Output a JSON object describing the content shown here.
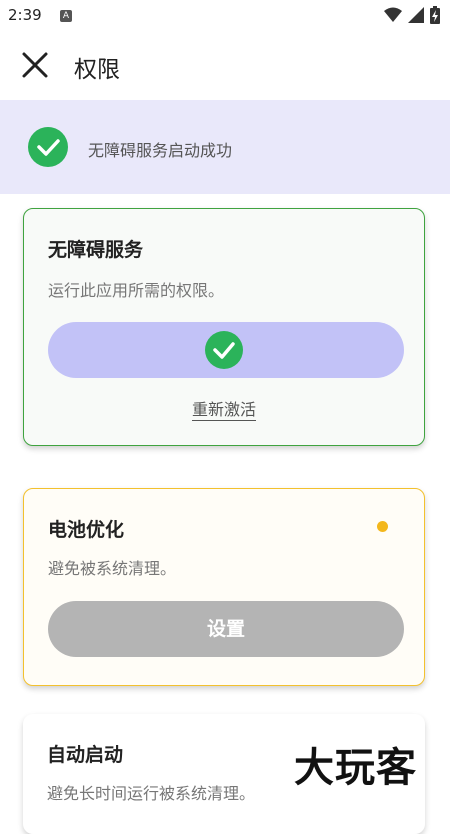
{
  "status_bar": {
    "time": "2:39",
    "notification_badge": "A",
    "icons": [
      "wifi-icon",
      "signal-icon",
      "battery-charging-icon"
    ]
  },
  "app_bar": {
    "title": "权限",
    "close_icon": "close-icon"
  },
  "banner": {
    "text": "无障碍服务启动成功",
    "icon": "check-circle-icon",
    "color": "#2bb35a"
  },
  "cards": [
    {
      "title": "无障碍服务",
      "description": "运行此应用所需的权限。",
      "state": "granted",
      "action_link": "重新激活",
      "border_color": "#3fa33f"
    },
    {
      "title": "电池优化",
      "description": "避免被系统清理。",
      "state": "pending",
      "button_label": "设置",
      "border_color": "#f3c12e",
      "dot_color": "#f3b71c"
    },
    {
      "title": "自动启动",
      "description": "避免长时间运行被系统清理。"
    }
  ],
  "watermark": "大玩客"
}
